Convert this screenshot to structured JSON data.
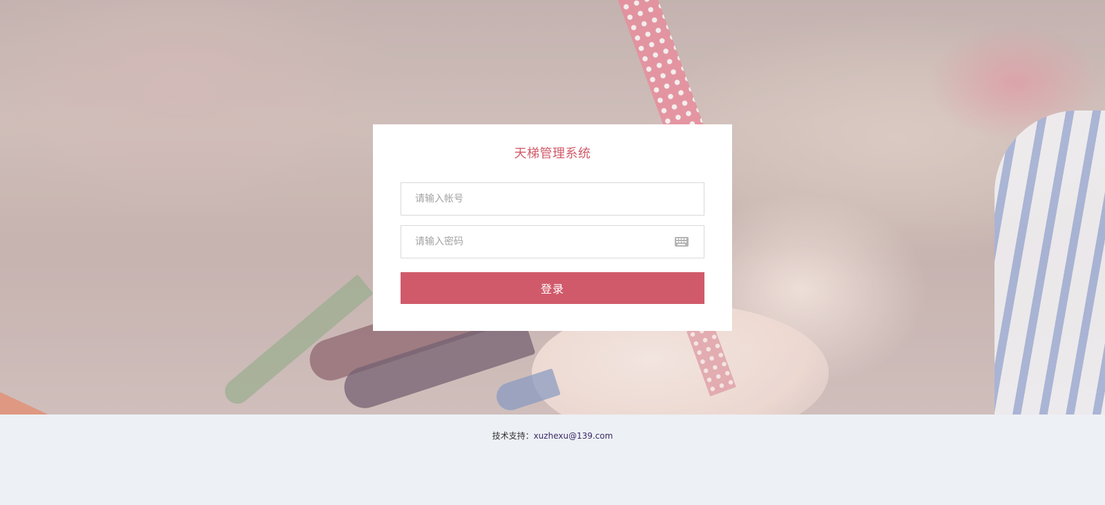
{
  "login": {
    "title": "天梯管理系统",
    "account_placeholder": "请输入帐号",
    "password_placeholder": "请输入密码",
    "submit_label": "登录"
  },
  "footer": {
    "support_label": "技术支持：",
    "support_email": "xuzhexu@139.com"
  },
  "icons": {
    "password_field_icon": "keyboard-icon"
  },
  "colors": {
    "accent": "#d05a6a",
    "footer_background": "#edf0f5",
    "card_background": "#ffffff"
  }
}
